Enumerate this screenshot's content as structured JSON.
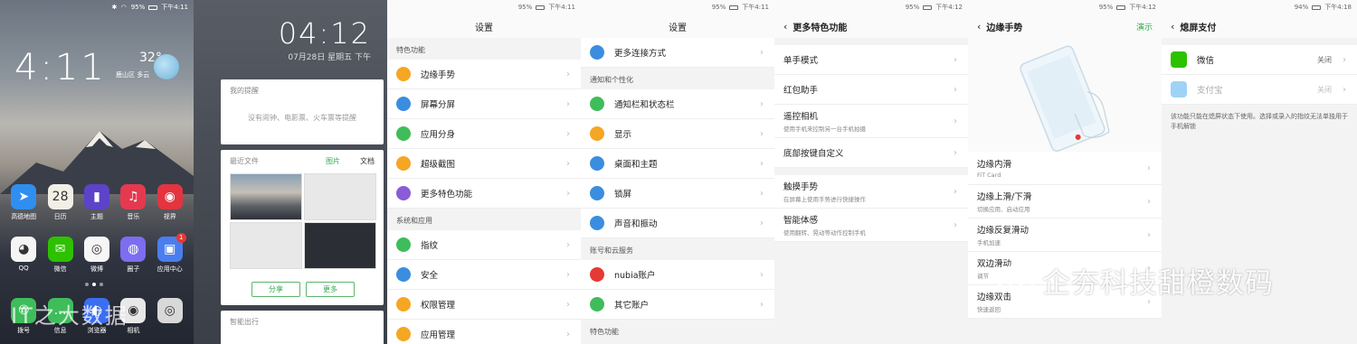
{
  "status": {
    "p1": {
      "batt": "95%",
      "time": "下午4:11"
    },
    "p3": {
      "batt": "95%",
      "time": "下午4:11"
    },
    "p4": {
      "batt": "95%",
      "time": "下午4:11"
    },
    "p5": {
      "batt": "95%",
      "time": "下午4:12"
    },
    "p6": {
      "batt": "95%",
      "time": "下午4:12"
    },
    "p7": {
      "batt": "94%",
      "time": "下午4:18"
    }
  },
  "home": {
    "clock": "4:11",
    "temp": "32°",
    "location": "鹿山区 多云",
    "row1": [
      {
        "label": "高德地图",
        "icon": "map-icon",
        "glyph": "➤",
        "color": "#2f8ff0"
      },
      {
        "label": "日历",
        "icon": "calendar-icon",
        "glyph": "28",
        "color": "#f2efe6"
      },
      {
        "label": "主题",
        "icon": "theme-brush-icon",
        "glyph": "▮",
        "color": "#5c43c9"
      },
      {
        "label": "音乐",
        "icon": "music-icon",
        "glyph": "♫",
        "color": "#e5394f"
      },
      {
        "label": "视界",
        "icon": "video-icon",
        "glyph": "◉",
        "color": "#e3343f"
      }
    ],
    "row2": [
      {
        "label": "QQ",
        "icon": "qq-icon",
        "glyph": "◕",
        "color": "#f5f5f5"
      },
      {
        "label": "微信",
        "icon": "wechat-icon",
        "glyph": "✉",
        "color": "#2dc100"
      },
      {
        "label": "微博",
        "icon": "weibo-icon",
        "glyph": "◎",
        "color": "#f6f6f6"
      },
      {
        "label": "圈子",
        "icon": "circle-icon",
        "glyph": "◍",
        "color": "#7d6df0"
      },
      {
        "label": "应用中心",
        "icon": "app-center-icon",
        "glyph": "▣",
        "color": "#4a7ef0",
        "badge": "1"
      }
    ],
    "row3": [
      {
        "label": "拨号",
        "icon": "phone-icon",
        "glyph": "✆",
        "color": "#3fbd5a"
      },
      {
        "label": "信息",
        "icon": "message-icon",
        "glyph": "…",
        "color": "#3fbd5a"
      },
      {
        "label": "浏览器",
        "icon": "browser-icon",
        "glyph": "◐",
        "color": "#3b6ef0"
      },
      {
        "label": "相机",
        "icon": "camera-icon",
        "glyph": "◉",
        "color": "#e8e8e8"
      },
      {
        "label": "",
        "icon": "camera-lens-icon",
        "glyph": "◎",
        "color": "#d8d8d8"
      }
    ],
    "watermark": "IT之大数据"
  },
  "notify": {
    "clock": "04:12",
    "date": "07月28日 星期五 下午",
    "reminder_title": "我的提醒",
    "reminder_empty": "没有闹钟、电影票、火车票等提醒",
    "recent_title": "最近文件",
    "tab_pictures": "图片",
    "tab_docs": "文档",
    "share": "分享",
    "more": "更多",
    "smart_travel": "智能出行"
  },
  "settings1": {
    "title": "设置",
    "sec1": "特色功能",
    "items1": [
      {
        "label": "边缘手势",
        "icon": "edge-gesture-icon",
        "color": "#f5a623"
      },
      {
        "label": "屏幕分屏",
        "icon": "split-screen-icon",
        "color": "#3b8de0"
      },
      {
        "label": "应用分身",
        "icon": "app-clone-icon",
        "color": "#3fbd5a"
      },
      {
        "label": "超级截图",
        "icon": "screenshot-icon",
        "color": "#f5a623"
      },
      {
        "label": "更多特色功能",
        "icon": "more-features-icon",
        "color": "#8a5cd8"
      }
    ],
    "sec2": "系统和应用",
    "items2": [
      {
        "label": "指纹",
        "icon": "fingerprint-icon",
        "color": "#3fbd5a"
      },
      {
        "label": "安全",
        "icon": "shield-icon",
        "color": "#3b8de0"
      },
      {
        "label": "权限管理",
        "icon": "permission-icon",
        "color": "#f5a623"
      },
      {
        "label": "应用管理",
        "icon": "app-manage-icon",
        "color": "#f5a623"
      }
    ]
  },
  "settings2": {
    "title": "设置",
    "top_item": {
      "label": "更多连接方式",
      "icon": "connection-icon",
      "color": "#3b8de0"
    },
    "sec1": "通知和个性化",
    "items1": [
      {
        "label": "通知栏和状态栏",
        "icon": "notification-icon",
        "color": "#3fbd5a"
      },
      {
        "label": "显示",
        "icon": "display-icon",
        "color": "#f5a623"
      },
      {
        "label": "桌面和主题",
        "icon": "desktop-theme-icon",
        "color": "#3b8de0"
      },
      {
        "label": "锁屏",
        "icon": "lock-icon",
        "color": "#3b8de0"
      },
      {
        "label": "声音和振动",
        "icon": "sound-icon",
        "color": "#3b8de0"
      }
    ],
    "sec2": "账号和云服务",
    "items2": [
      {
        "label": "nubia账户",
        "icon": "nubia-account-icon",
        "color": "#e53935"
      },
      {
        "label": "其它账户",
        "icon": "other-account-icon",
        "color": "#3fbd5a"
      }
    ],
    "sec3": "特色功能"
  },
  "more_features": {
    "title": "更多特色功能",
    "items": [
      {
        "label": "单手模式",
        "sub": ""
      },
      {
        "label": "红包助手",
        "sub": ""
      },
      {
        "label": "遥控相机",
        "sub": "使用手机来控制另一台手机拍摄"
      },
      {
        "label": "底部按键自定义",
        "sub": ""
      },
      {
        "label": "触摸手势",
        "sub": "在屏幕上使用手势进行快捷操作"
      },
      {
        "label": "智能体感",
        "sub": "使用翻转、晃动等动作控制手机"
      }
    ]
  },
  "edge": {
    "title": "边缘手势",
    "demo": "演示",
    "items": [
      {
        "label": "边缘内滑",
        "sub": "FiT Card"
      },
      {
        "label": "边缘上滑/下滑",
        "sub": "切换应用、启动应用"
      },
      {
        "label": "边缘反复滑动",
        "sub": "手机加速"
      },
      {
        "label": "双边滑动",
        "sub": "调节"
      },
      {
        "label": "边缘双击",
        "sub": "快速返回"
      }
    ]
  },
  "pay": {
    "title": "熄屏支付",
    "items": [
      {
        "label": "微信",
        "value": "关闭",
        "icon": "wechat-pay-icon",
        "color": "#2dc100"
      },
      {
        "label": "支付宝",
        "value": "关闭",
        "icon": "alipay-icon",
        "color": "#9fd3f5"
      }
    ],
    "note": "该功能只能在熄屏状态下使用。选择或录入的指纹无法单独用于手机解锁"
  },
  "watermark": "企夯科技甜橙数码"
}
